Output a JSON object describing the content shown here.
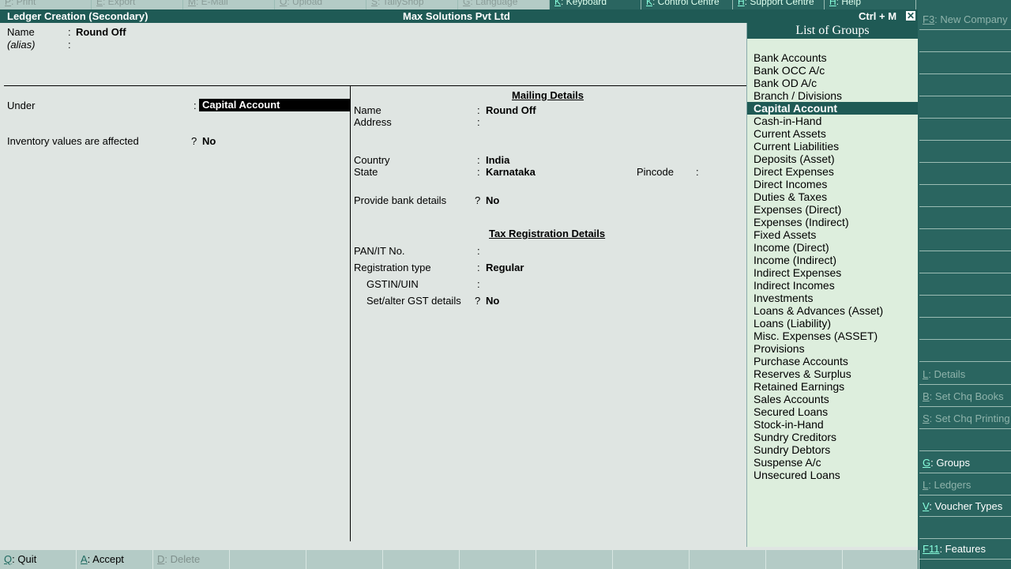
{
  "top_menu": [
    {
      "key": "P",
      "label": ": Print"
    },
    {
      "key": "E",
      "label": ": Export"
    },
    {
      "key": "M",
      "label": ": E-Mail"
    },
    {
      "key": "O",
      "label": ": Upload"
    },
    {
      "key": "S",
      "label": ": TallyShop"
    },
    {
      "key": "G",
      "label": ": Language"
    },
    {
      "key": "K",
      "label": ": Keyboard"
    },
    {
      "key": "K",
      "label": ": Control Centre"
    },
    {
      "key": "H",
      "label": ": Support Centre"
    },
    {
      "key": "H",
      "label": ": Help"
    }
  ],
  "title": {
    "left": "Ledger Creation (Secondary)",
    "center": "Max Solutions Pvt Ltd",
    "right": "Ctrl + M",
    "close_glyph": "✕"
  },
  "form": {
    "name_label": "Name",
    "name_colon": ":",
    "name_value": "Round Off",
    "alias_label": "(alias)",
    "alias_colon": ":",
    "under_label": "Under",
    "under_colon": ":",
    "under_value": "Capital Account",
    "inventory_label": "Inventory values are affected",
    "inventory_q": "?",
    "inventory_value": "No"
  },
  "mailing": {
    "title": "Mailing Details",
    "name_label": "Name",
    "name_colon": ":",
    "name_value": "Round Off",
    "address_label": "Address",
    "address_colon": ":",
    "country_label": "Country",
    "country_colon": ":",
    "country_value": "India",
    "state_label": "State",
    "state_colon": ":",
    "state_value": "Karnataka",
    "pincode_label": "Pincode",
    "pincode_colon": ":",
    "bank_label": "Provide bank details",
    "bank_q": "?",
    "bank_value": "No"
  },
  "tax": {
    "title": "Tax Registration Details",
    "pan_label": "PAN/IT No.",
    "pan_colon": ":",
    "regtype_label": "Registration type",
    "regtype_colon": ":",
    "regtype_value": "Regular",
    "gstin_label": "GSTIN/UIN",
    "gstin_colon": ":",
    "gst_label": "Set/alter GST details",
    "gst_q": "?",
    "gst_value": "No"
  },
  "groups": {
    "title": "List of Groups",
    "selected": "Capital Account",
    "items": [
      "Bank Accounts",
      "Bank OCC A/c",
      "Bank OD A/c",
      "Branch / Divisions",
      "Capital Account",
      "Cash-in-Hand",
      "Current Assets",
      "Current Liabilities",
      "Deposits (Asset)",
      "Direct Expenses",
      "Direct Incomes",
      "Duties & Taxes",
      "Expenses (Direct)",
      "Expenses (Indirect)",
      "Fixed Assets",
      "Income (Direct)",
      "Income (Indirect)",
      "Indirect Expenses",
      "Indirect Incomes",
      "Investments",
      "Loans & Advances (Asset)",
      "Loans (Liability)",
      "Misc. Expenses (ASSET)",
      "Provisions",
      "Purchase Accounts",
      "Reserves & Surplus",
      "Retained Earnings",
      "Sales Accounts",
      "Secured Loans",
      "Stock-in-Hand",
      "Sundry Creditors",
      "Sundry Debtors",
      "Suspense A/c",
      "Unsecured Loans"
    ]
  },
  "right_panel": {
    "f3_key": "F3",
    "f3_label": ": New Company",
    "details_key": "L",
    "details_label": ": Details",
    "chqbooks_key": "B",
    "chqbooks_label": ": Set Chq Books",
    "chqprint_key": "S",
    "chqprint_label": ": Set Chq Printing",
    "groups_key": "G",
    "groups_label": ": Groups",
    "ledgers_key": "L",
    "ledgers_label": ": Ledgers",
    "vtypes_key": "V",
    "vtypes_label": ": Voucher Types",
    "f11_key": "F11",
    "f11_label": ": Features"
  },
  "bottom_bar": {
    "quit_key": "Q",
    "quit_label": ": Quit",
    "accept_key": "A",
    "accept_label": ": Accept",
    "delete_key": "D",
    "delete_label": ": Delete"
  }
}
